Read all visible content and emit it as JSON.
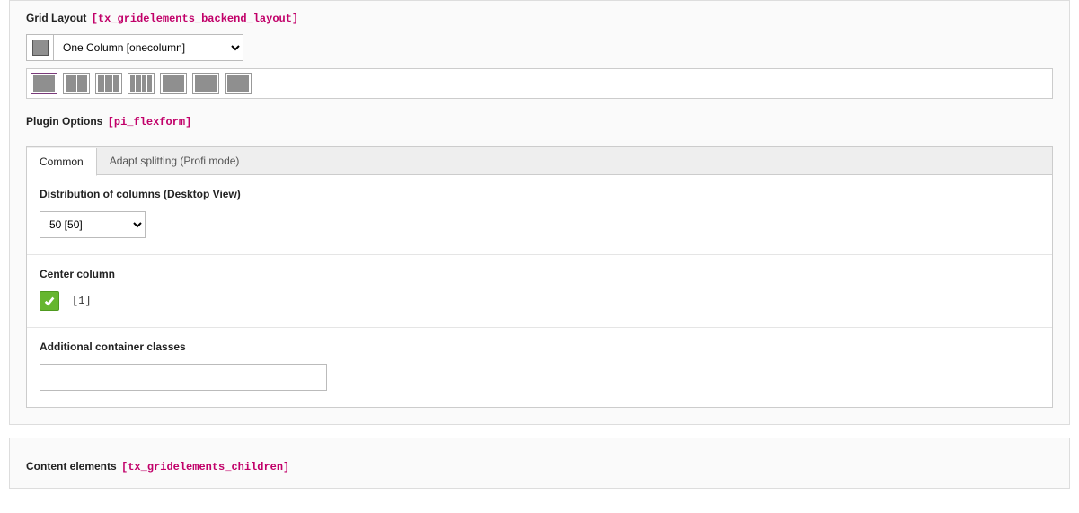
{
  "grid_layout": {
    "label": "Grid Layout",
    "tech": "[tx_gridelements_backend_layout]",
    "select_value": "One Column [onecolumn]",
    "options": [
      "One Column [onecolumn]"
    ],
    "thumbs": [
      {
        "cols": 1,
        "selected": true
      },
      {
        "cols": 2,
        "selected": false
      },
      {
        "cols": 3,
        "selected": false
      },
      {
        "cols": 4,
        "selected": false
      },
      {
        "cols": 1,
        "selected": false
      },
      {
        "cols": 1,
        "selected": false
      },
      {
        "cols": 1,
        "selected": false
      }
    ]
  },
  "plugin_options": {
    "label": "Plugin Options",
    "tech": "[pi_flexform]",
    "tabs": [
      {
        "label": "Common",
        "active": true
      },
      {
        "label": "Adapt splitting (Profi mode)",
        "active": false
      }
    ],
    "distribution": {
      "label": "Distribution of columns (Desktop View)",
      "value": "50 [50]",
      "options": [
        "50 [50]"
      ]
    },
    "center_column": {
      "label": "Center column",
      "checked": true,
      "value_text": "[1]"
    },
    "additional_classes": {
      "label": "Additional container classes",
      "value": ""
    }
  },
  "content_elements": {
    "label": "Content elements",
    "tech": "[tx_gridelements_children]"
  }
}
